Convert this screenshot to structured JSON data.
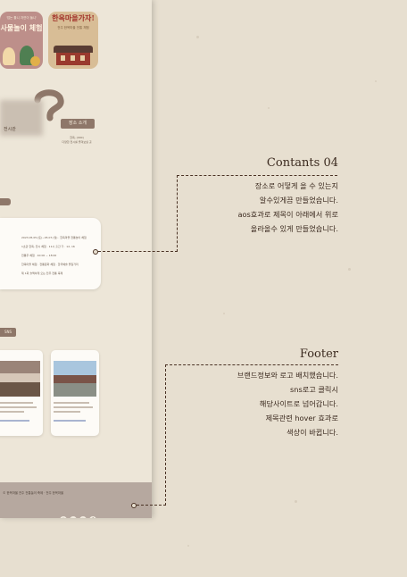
{
  "preview": {
    "card1": {
      "subtitle": "'덥는 틀니 자연이 돌니'",
      "title": "사물놀이 체험"
    },
    "card2": {
      "title": "한옥마을가자!",
      "subtitle": "전주 한옥마을 전통 체험"
    },
    "place": {
      "name": "전시관",
      "tag": "장소 소개",
      "desc_1": "한옥, (000)",
      "desc_2": "다양한 전시를 즐겨보실 곳"
    },
    "info_rows": [
      "2023.05.05.(토)~05.07.(월) · 한옥마을 전통놀이 체험",
      "1초관 한옥, 전시 체험 · 11시 출간 가 · 12, 16",
      "전통주 체험 · 10:00 ~ 18:00",
      "한옥마을 체험 · 전통문화 체험 · 한국예술 즐길거리",
      "제 1회 슬쩍하게 오는 전주 전통 축제"
    ],
    "sns_tag": "SNS",
    "footer_text": "© 한옥마을 전주 전통놀이 축제   · 전주 한옥마을",
    "sns_icons": [
      "instagram-icon",
      "youtube-icon",
      "twitter-icon",
      "facebook-icon"
    ]
  },
  "annotations": {
    "contents": {
      "title": "Contants 04",
      "lines": [
        "장소로 어떻게 올 수 있는지",
        "알수있게끔 만들었습니다.",
        "aos효과로 제목이 아래에서 위로",
        "올라올수 있게 만들었습니다."
      ]
    },
    "footer": {
      "title": "Footer",
      "lines": [
        "브랜드정보와 로고 배치했습니다.",
        "sns로고 클릭시",
        "해당사이트로 넘어갑니다.",
        "제목관련 hover 효과로",
        "색상이 바뀝니다."
      ]
    }
  },
  "colors": {
    "background": "#e7dfd0",
    "accent_brown": "#8e7769",
    "footer": "#b6a89f",
    "ink": "#3b2a1f"
  }
}
